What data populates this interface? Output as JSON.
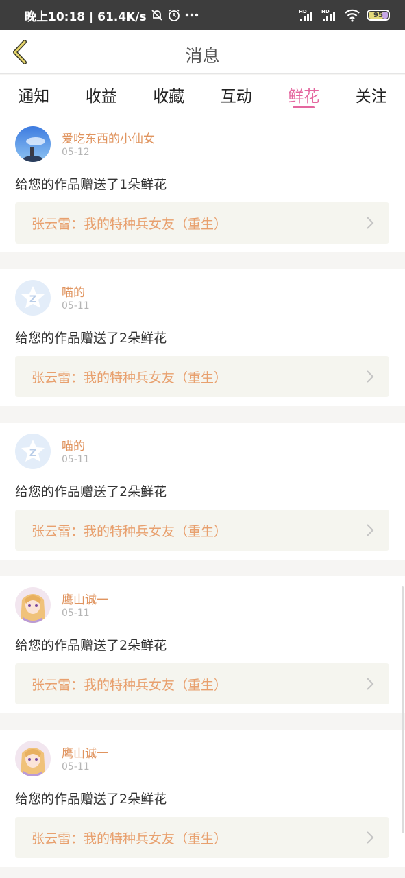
{
  "status_bar": {
    "time": "晚上10:18 | 61.4K/s",
    "battery": "95"
  },
  "header": {
    "title": "消息"
  },
  "tabs": [
    {
      "label": "通知"
    },
    {
      "label": "收益"
    },
    {
      "label": "收藏"
    },
    {
      "label": "互动"
    },
    {
      "label": "鲜花",
      "active": true
    },
    {
      "label": "关注"
    }
  ],
  "messages": [
    {
      "avatar": "avatar-sky",
      "name": "爱吃东西的小仙女",
      "date": "05-12",
      "text": "给您的作品赠送了1朵鲜花",
      "work": "张云雷：我的特种兵女友（重生）"
    },
    {
      "avatar": "avatar-default-z",
      "name": "喵的",
      "date": "05-11",
      "text": "给您的作品赠送了2朵鲜花",
      "work": "张云雷：我的特种兵女友（重生）"
    },
    {
      "avatar": "avatar-default-z",
      "name": "喵的",
      "date": "05-11",
      "text": "给您的作品赠送了2朵鲜花",
      "work": "张云雷：我的特种兵女友（重生）"
    },
    {
      "avatar": "avatar-anime",
      "name": "鹰山诚一",
      "date": "05-11",
      "text": "给您的作品赠送了2朵鲜花",
      "work": "张云雷：我的特种兵女友（重生）"
    },
    {
      "avatar": "avatar-anime",
      "name": "鹰山诚一",
      "date": "05-11",
      "text": "给您的作品赠送了2朵鲜花",
      "work": "张云雷：我的特种兵女友（重生）"
    }
  ]
}
